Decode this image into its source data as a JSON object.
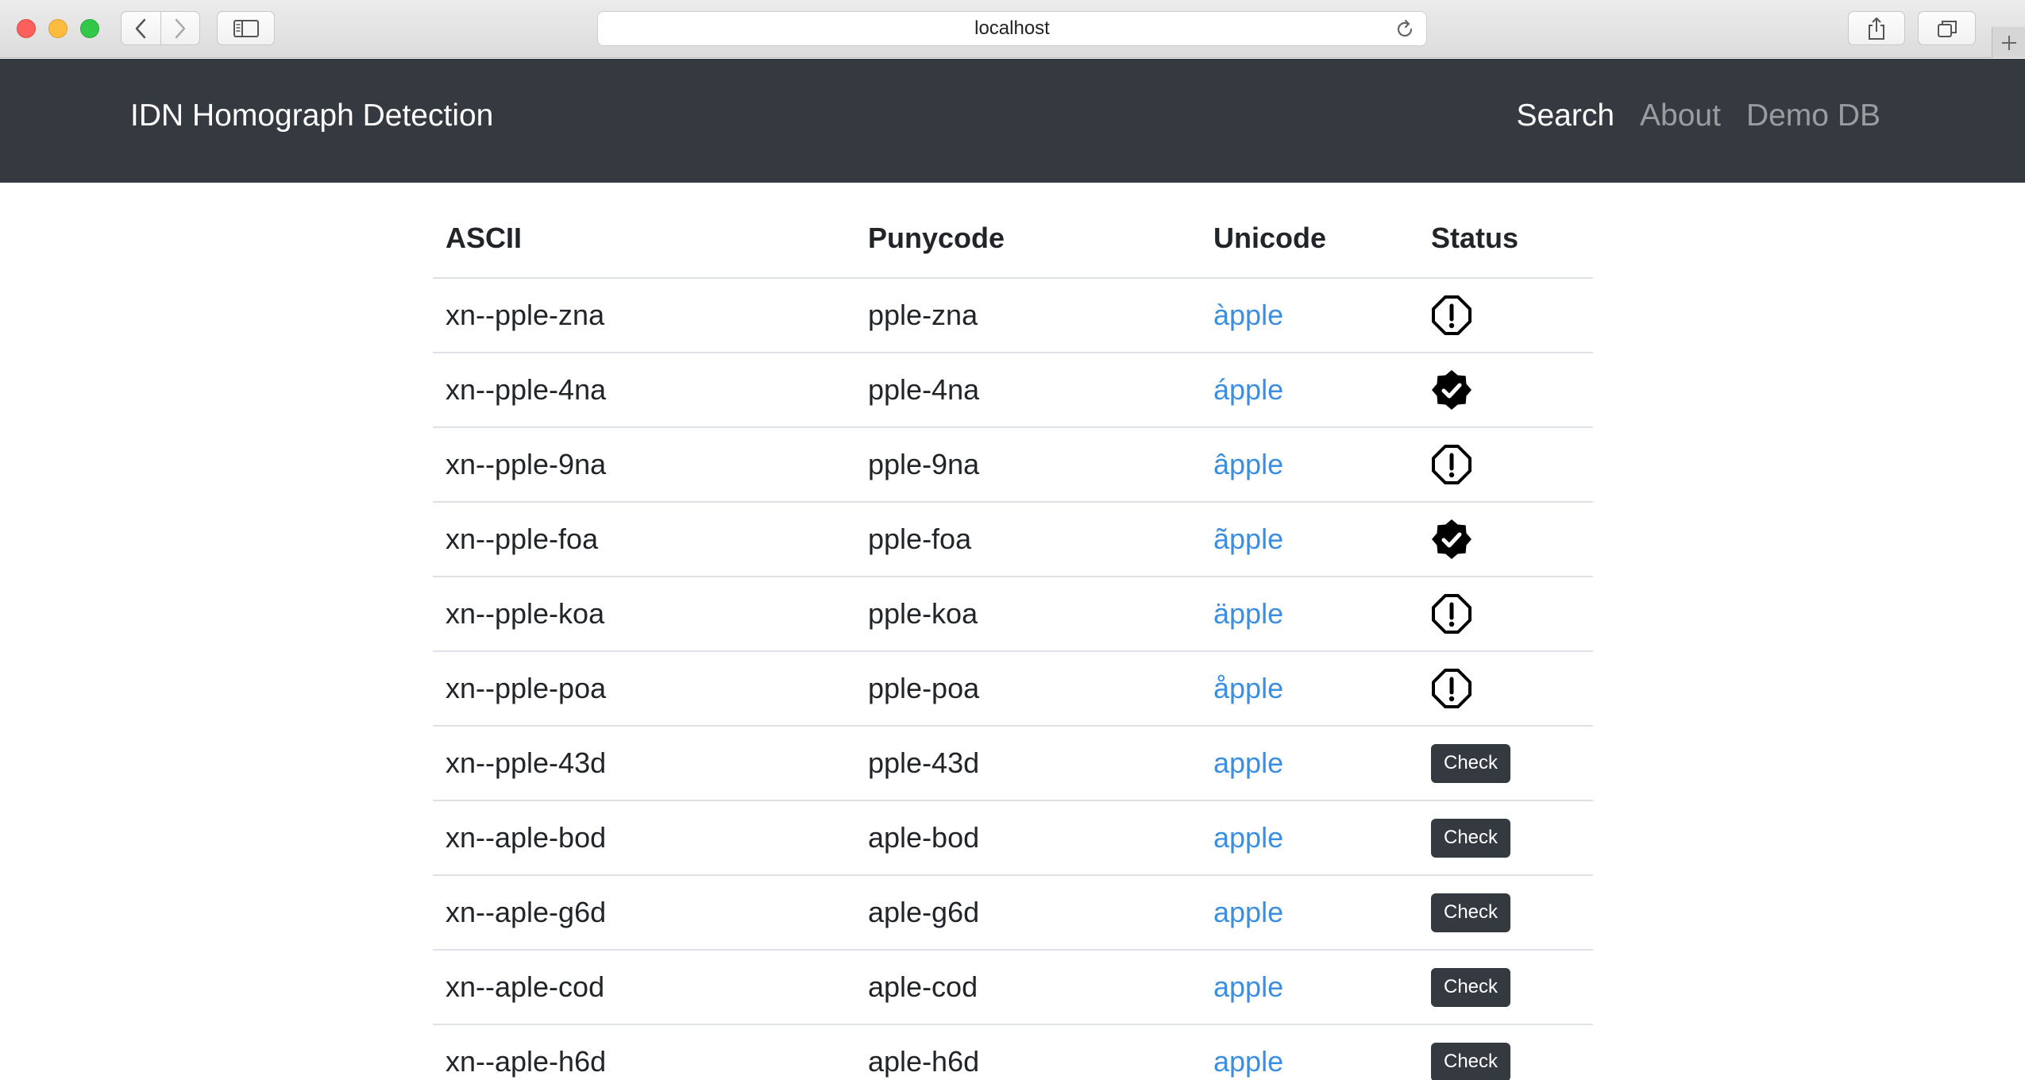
{
  "browser": {
    "url": "localhost"
  },
  "navbar": {
    "brand": "IDN Homograph Detection",
    "links": [
      {
        "label": "Search",
        "active": true
      },
      {
        "label": "About",
        "active": false
      },
      {
        "label": "Demo DB",
        "active": false
      }
    ]
  },
  "table": {
    "headers": [
      "ASCII",
      "Punycode",
      "Unicode",
      "Status"
    ],
    "rows": [
      {
        "ascii": "xn--pple-zna",
        "punycode": "pple-zna",
        "unicode": "àpple",
        "status": "warning-icon"
      },
      {
        "ascii": "xn--pple-4na",
        "punycode": "pple-4na",
        "unicode": "ápple",
        "status": "verified-icon"
      },
      {
        "ascii": "xn--pple-9na",
        "punycode": "pple-9na",
        "unicode": "âpple",
        "status": "warning-icon"
      },
      {
        "ascii": "xn--pple-foa",
        "punycode": "pple-foa",
        "unicode": "ãpple",
        "status": "verified-icon"
      },
      {
        "ascii": "xn--pple-koa",
        "punycode": "pple-koa",
        "unicode": "äpple",
        "status": "warning-icon"
      },
      {
        "ascii": "xn--pple-poa",
        "punycode": "pple-poa",
        "unicode": "åpple",
        "status": "warning-icon"
      },
      {
        "ascii": "xn--pple-43d",
        "punycode": "pple-43d",
        "unicode": "apple",
        "status": "button",
        "button_label": "Check"
      },
      {
        "ascii": "xn--aple-bod",
        "punycode": "aple-bod",
        "unicode": "apple",
        "status": "button",
        "button_label": "Check"
      },
      {
        "ascii": "xn--aple-g6d",
        "punycode": "aple-g6d",
        "unicode": "apple",
        "status": "button",
        "button_label": "Check"
      },
      {
        "ascii": "xn--aple-cod",
        "punycode": "aple-cod",
        "unicode": "apple",
        "status": "button",
        "button_label": "Check"
      },
      {
        "ascii": "xn--aple-h6d",
        "punycode": "aple-h6d",
        "unicode": "apple",
        "status": "button",
        "button_label": "Check"
      }
    ]
  },
  "colors": {
    "navbar_bg": "#343a40",
    "link": "#3b8fe0",
    "button_bg": "#343a40"
  }
}
